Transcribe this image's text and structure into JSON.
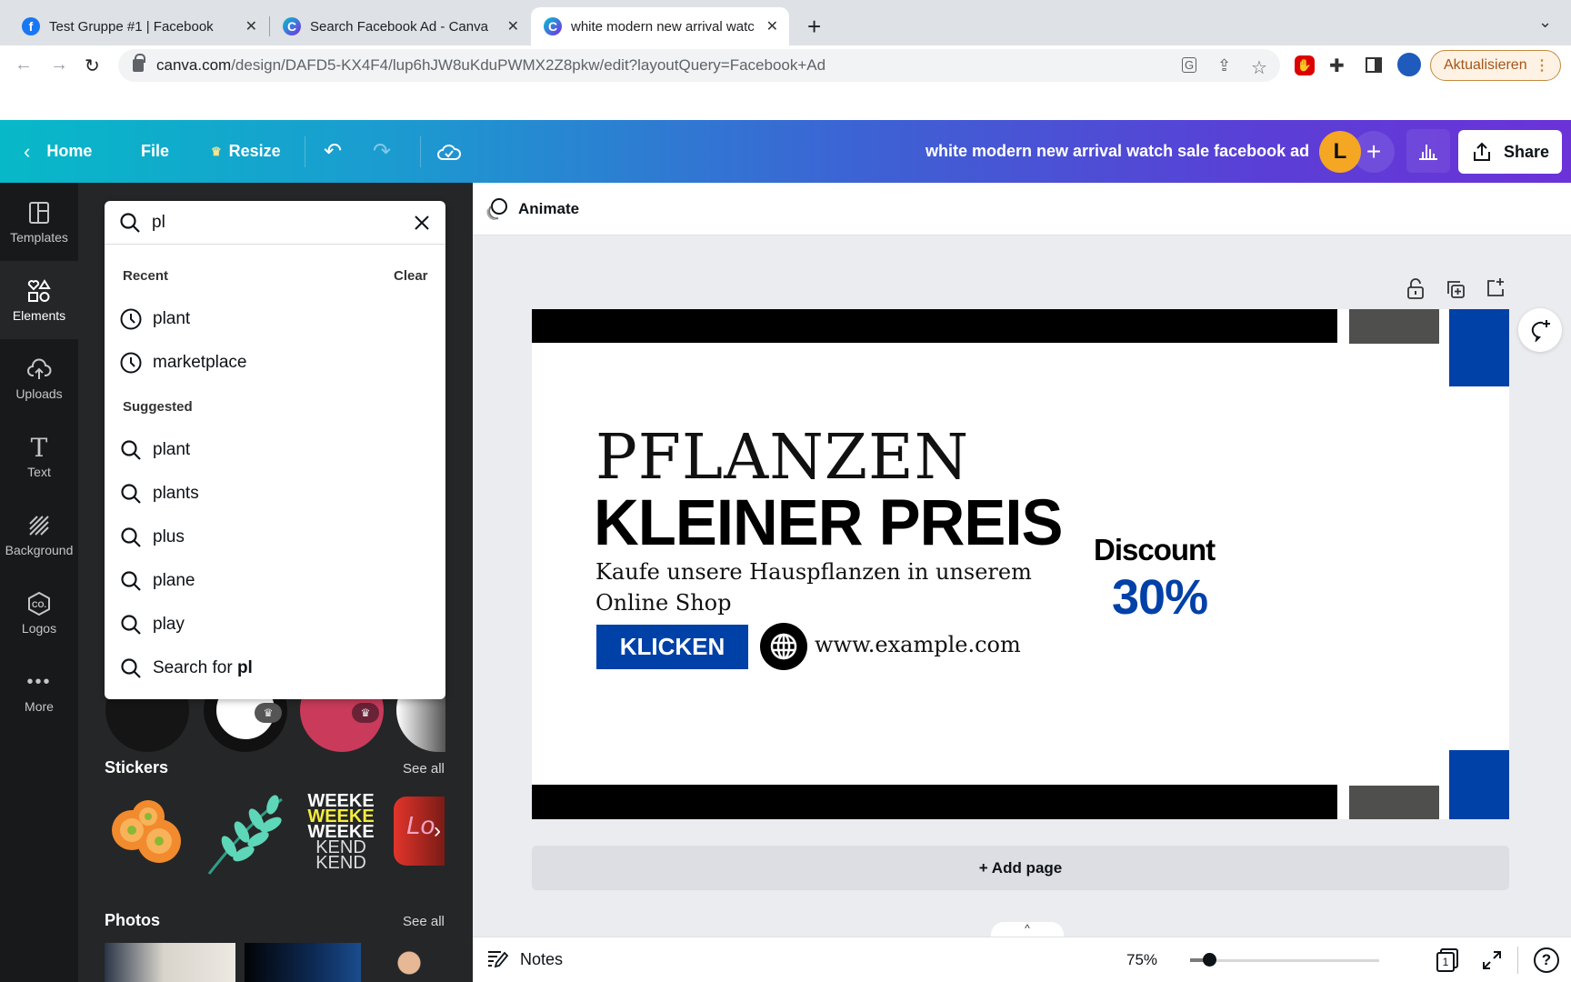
{
  "browser": {
    "tabs": [
      {
        "title": "Test Gruppe #1 | Facebook",
        "favicon": "facebook-icon",
        "active": false
      },
      {
        "title": "Search Facebook Ad - Canva",
        "favicon": "canva-icon",
        "active": false
      },
      {
        "title": "white modern new arrival watc",
        "favicon": "canva-icon",
        "active": true
      }
    ],
    "close_glyph": "✕",
    "new_tab_glyph": "+",
    "tab_menu_glyph": "⌄",
    "url_host": "canva.com",
    "url_path": "/design/DAFD5-KX4F4/lup6hJW8uKduPWMX2Z8pkw/edit?layoutQuery=Facebook+Ad",
    "update_button": "Aktualisieren"
  },
  "header": {
    "home": "Home",
    "file": "File",
    "resize": "Resize",
    "design_title": "white modern new arrival watch sale facebook ad",
    "avatar_initial": "L",
    "share": "Share",
    "colors": {
      "gradient_start": "#07b9c8",
      "gradient_end": "#6b32d8"
    }
  },
  "sidebar": {
    "items": [
      {
        "label": "Templates",
        "icon": "templates-icon",
        "active": false
      },
      {
        "label": "Elements",
        "icon": "elements-icon",
        "active": true
      },
      {
        "label": "Uploads",
        "icon": "upload-cloud-icon",
        "active": false
      },
      {
        "label": "Text",
        "icon": "text-icon",
        "active": false
      },
      {
        "label": "Background",
        "icon": "background-icon",
        "active": false
      },
      {
        "label": "Logos",
        "icon": "logos-icon",
        "active": false
      },
      {
        "label": "More",
        "icon": "more-icon",
        "active": false
      }
    ]
  },
  "search": {
    "value": "pl",
    "recent_label": "Recent",
    "clear_label": "Clear",
    "recent": [
      "plant",
      "marketplace"
    ],
    "suggested_label": "Suggested",
    "suggested": [
      "plant",
      "plants",
      "plus",
      "plane",
      "play"
    ],
    "search_for_prefix": "Search for ",
    "search_for_term": "pl"
  },
  "panel": {
    "stickers_title": "Stickers",
    "photos_title": "Photos",
    "see_all": "See all",
    "stickers": [
      "orange-flowers-sticker",
      "green-leaf-sticker",
      "weekend-text-sticker",
      "love-speech-bubble-sticker"
    ],
    "photos": [
      "business-handshake-photo",
      "blue-texture-photo",
      "smiling-people-photo"
    ]
  },
  "editor": {
    "animate": "Animate",
    "add_page": "+ Add page",
    "notes": "Notes",
    "zoom_level": "75%",
    "zoom_fraction": 0.1,
    "page_count": "1",
    "expand_glyph": "^"
  },
  "design": {
    "headline_1": "PFLANZEN",
    "headline_2": "KLEINER PREIS",
    "body_line_1": "Kaufe unsere Hauspflanzen in unserem",
    "body_line_2": "Online Shop",
    "cta": "KLICKEN",
    "website": "www.example.com",
    "discount_label": "Discount",
    "discount_value": "30%",
    "colors": {
      "accent_blue": "#0041a8",
      "bar_black": "#000000",
      "bar_gray": "#4f4f4d"
    }
  }
}
